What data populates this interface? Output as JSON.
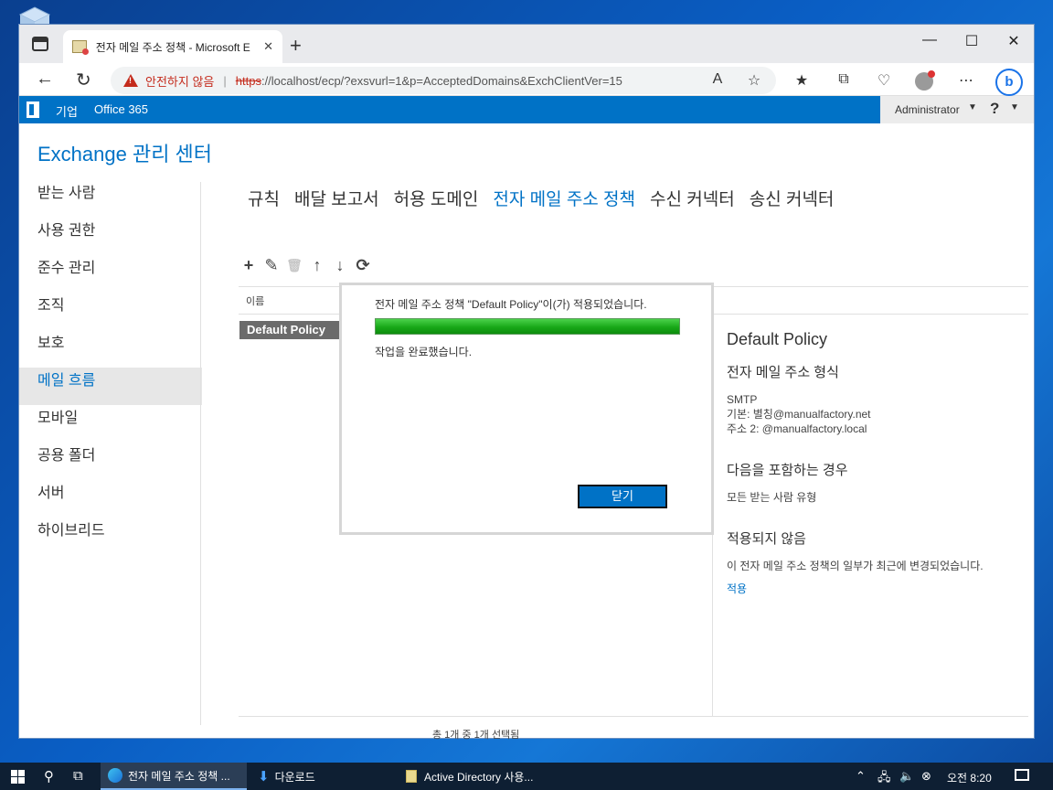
{
  "browser": {
    "tab_title": "전자 메일 주소 정책 - Microsoft E",
    "tab_close": "✕",
    "new_tab": "+",
    "window_controls": [
      "—",
      "☐",
      "✕"
    ],
    "insecure_label": "안전하지 않음",
    "url_scheme": "https",
    "url_rest": "://localhost/ecp/?exsvurl=1&p=AcceptedDomains&ExchClientVer=15",
    "toolbar_icons": [
      "read-aloud-icon",
      "favorite-icon",
      "favorites-icon",
      "collections-icon",
      "health-icon",
      "profile-icon",
      "more-icon",
      "bing-icon"
    ],
    "bing_label": "b"
  },
  "o365": {
    "enterprise_label": "기업",
    "office_label": "Office 365",
    "admin_name": "Administrator",
    "help_label": "?"
  },
  "page": {
    "title": "Exchange 관리 센터",
    "nav": [
      "받는 사람",
      "사용 권한",
      "준수 관리",
      "조직",
      "보호",
      "메일 흐름",
      "모바일",
      "공용 폴더",
      "서버",
      "하이브리드"
    ],
    "active_nav": "메일 흐름",
    "subnav": [
      "규칙",
      "배달 보고서",
      "허용 도메인",
      "전자 메일 주소 정책",
      "수신 커넥터",
      "송신 커넥터"
    ],
    "active_subnav": "전자 메일 주소 정책",
    "column_name": "이름",
    "selected_row": "Default Policy",
    "footer": "총 1개 중 1개 선택됨"
  },
  "detail": {
    "title": "Default Policy",
    "format_heading": "전자 메일 주소 형식",
    "format_lines": [
      "SMTP",
      "기본: 별칭@manualfactory.net",
      "주소 2: @manualfactory.local"
    ],
    "include_heading": "다음을 포함하는 경우",
    "include_text": "모든 받는 사람 유형",
    "not_applied_heading": "적용되지 않음",
    "not_applied_text": "이 전자 메일 주소 정책의 일부가 최근에 변경되었습니다.",
    "apply_link": "적용"
  },
  "dialog": {
    "message": "전자 메일 주소 정책 \"Default Policy\"이(가) 적용되었습니다.",
    "progress": 1.0,
    "done_text": "작업을 완료했습니다.",
    "close_button": "닫기"
  },
  "taskbar": {
    "items": [
      "전자 메일 주소 정책 ...",
      "다운로드",
      "Active Directory 사용..."
    ],
    "clock": "오전 8:20"
  },
  "colors": {
    "accent": "#0072c6",
    "progress_green": "#18a818",
    "taskbar": "#0e1f33"
  }
}
